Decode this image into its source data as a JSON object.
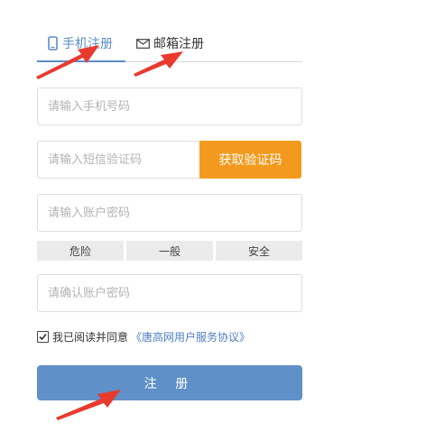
{
  "tabs": {
    "phone_label": "手机注册",
    "email_label": "邮箱注册"
  },
  "form": {
    "phone_placeholder": "请输入手机号码",
    "code_placeholder": "请输入短信验证码",
    "get_code_label": "获取验证码",
    "password_placeholder": "请输入账户密码",
    "strength": [
      "危险",
      "一般",
      "安全"
    ],
    "confirm_placeholder": "请确认账户密码",
    "agree_text": "我已阅读并同意",
    "agree_link": "《唐高网用户服务协议》",
    "agree_checked": true,
    "submit_label": "注 册"
  },
  "colors": {
    "accent": "#5b8cc8",
    "code_button": "#f39a1e",
    "submit": "#6090c8",
    "arrow": "#e83a2e"
  }
}
